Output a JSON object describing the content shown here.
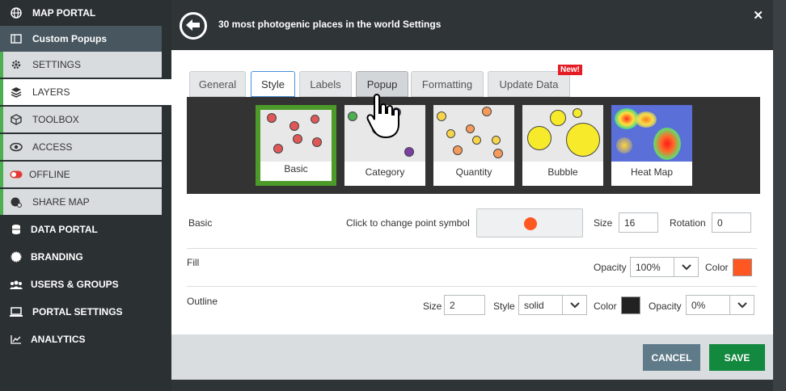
{
  "sidebar": {
    "items": [
      {
        "label": "MAP PORTAL",
        "icon": "globe-icon"
      },
      {
        "label": "Custom Popups",
        "icon": "map-icon"
      },
      {
        "label": "SETTINGS",
        "icon": "gear-icon"
      },
      {
        "label": "LAYERS",
        "icon": "layers-icon"
      },
      {
        "label": "TOOLBOX",
        "icon": "box-icon"
      },
      {
        "label": "ACCESS",
        "icon": "eye-icon"
      },
      {
        "label": "OFFLINE",
        "icon": "toggle-icon"
      },
      {
        "label": "SHARE MAP",
        "icon": "share-globe-icon"
      },
      {
        "label": "DATA PORTAL",
        "icon": "database-icon"
      },
      {
        "label": "BRANDING",
        "icon": "badge-icon"
      },
      {
        "label": "USERS & GROUPS",
        "icon": "users-icon"
      },
      {
        "label": "PORTAL SETTINGS",
        "icon": "laptop-icon"
      },
      {
        "label": "ANALYTICS",
        "icon": "chart-icon"
      }
    ]
  },
  "modal": {
    "title": "30 most photogenic places in the world Settings",
    "tabs": [
      {
        "label": "General"
      },
      {
        "label": "Style"
      },
      {
        "label": "Labels"
      },
      {
        "label": "Popup"
      },
      {
        "label": "Formatting"
      },
      {
        "label": "Update Data"
      }
    ],
    "new_badge": "New!",
    "styles": [
      {
        "label": "Basic"
      },
      {
        "label": "Category"
      },
      {
        "label": "Quantity"
      },
      {
        "label": "Bubble"
      },
      {
        "label": "Heat Map"
      }
    ],
    "basic": {
      "label": "Basic",
      "change_symbol_label": "Click to change point symbol",
      "size_label": "Size",
      "size_value": "16",
      "rotation_label": "Rotation",
      "rotation_value": "0",
      "symbol_color": "#ff5722"
    },
    "fill": {
      "label": "Fill",
      "opacity_label": "Opacity",
      "opacity_value": "100%",
      "color_label": "Color",
      "color_value": "#ff5722"
    },
    "outline": {
      "label": "Outline",
      "size_label": "Size",
      "size_value": "2",
      "style_label": "Style",
      "style_value": "solid",
      "color_label": "Color",
      "color_value": "#222222",
      "opacity_label": "Opacity",
      "opacity_value": "0%"
    },
    "cancel_label": "CANCEL",
    "save_label": "SAVE"
  }
}
